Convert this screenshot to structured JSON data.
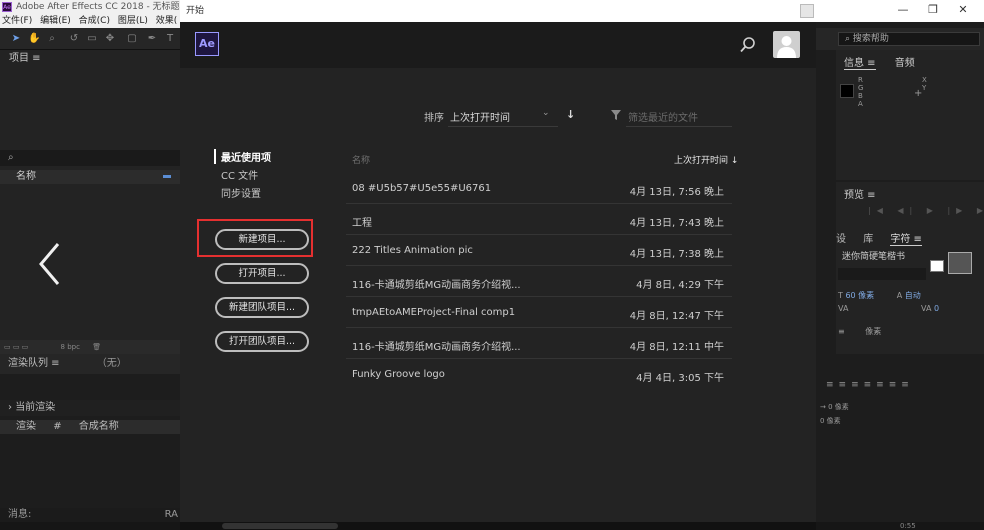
{
  "app": {
    "title": "Adobe After Effects CC 2018 - 无标题项",
    "menu": [
      "文件(F)",
      "编辑(E)",
      "合成(C)",
      "图层(L)",
      "效果("
    ]
  },
  "project_panel": {
    "title": "项目 ≡",
    "search_icon": "search-icon",
    "name_column": "名称",
    "footer_bpc": "8 bpc"
  },
  "render_queue": {
    "tab": "渲染队列 ≡",
    "none": "（无）",
    "current_render": "当前渲染",
    "columns": [
      "渲染",
      "#",
      "合成名称"
    ]
  },
  "status": {
    "label": "消息:",
    "ra": "RA"
  },
  "right_panel": {
    "help_search": "搜索帮助",
    "info_tabs": [
      "信息 ≡",
      "音频"
    ],
    "rgba": [
      "R",
      "G",
      "B",
      "A"
    ],
    "xy": [
      "X",
      "Y"
    ],
    "preview_title": "预览 ≡",
    "preview_controls": "|◀ ◀| ▶ |▶ ▶|",
    "char_tabs": [
      "设",
      "库",
      "字符 ≡"
    ],
    "font": "迷你简硬笔楷书",
    "font_size": "60 像素",
    "leading": "自动",
    "tracking": "0",
    "stroke": "像素",
    "indent_rows": [
      "→ 0 像素",
      "0 像素"
    ],
    "time": "0:55"
  },
  "dialog": {
    "title": "开始",
    "logo": "Ae",
    "sort_label": "排序",
    "sort_value": "上次打开时间",
    "sort_direction": "↓",
    "filter_placeholder": "筛选最近的文件",
    "nav": [
      "最近使用项",
      "CC 文件",
      "同步设置"
    ],
    "buttons": [
      "新建项目...",
      "打开项目...",
      "新建团队项目...",
      "打开团队项目..."
    ],
    "col_name": "名称",
    "col_opened": "上次打开时间",
    "recent": [
      {
        "name": "08 #U5b57#U5e55#U6761",
        "date": "4月 13日, 7:56 晚上"
      },
      {
        "name": "工程",
        "date": "4月 13日, 7:43 晚上"
      },
      {
        "name": "222 Titles Animation pic",
        "date": "4月 13日, 7:38 晚上"
      },
      {
        "name": "116-卡通城剪纸MG动画商务介绍视...",
        "date": "4月 8日, 4:29 下午"
      },
      {
        "name": "tmpAEtoAMEProject-Final comp1",
        "date": "4月 8日, 12:47 下午"
      },
      {
        "name": "116-卡通城剪纸MG动画商务介绍视...",
        "date": "4月 8日, 12:11 中午"
      },
      {
        "name": "Funky Groove logo",
        "date": "4月 4日, 3:05 下午"
      }
    ]
  },
  "colors": {
    "highlight": "#e53030",
    "ae_purple": "#9999ff",
    "font_size_blue": "#7fa8e0"
  }
}
